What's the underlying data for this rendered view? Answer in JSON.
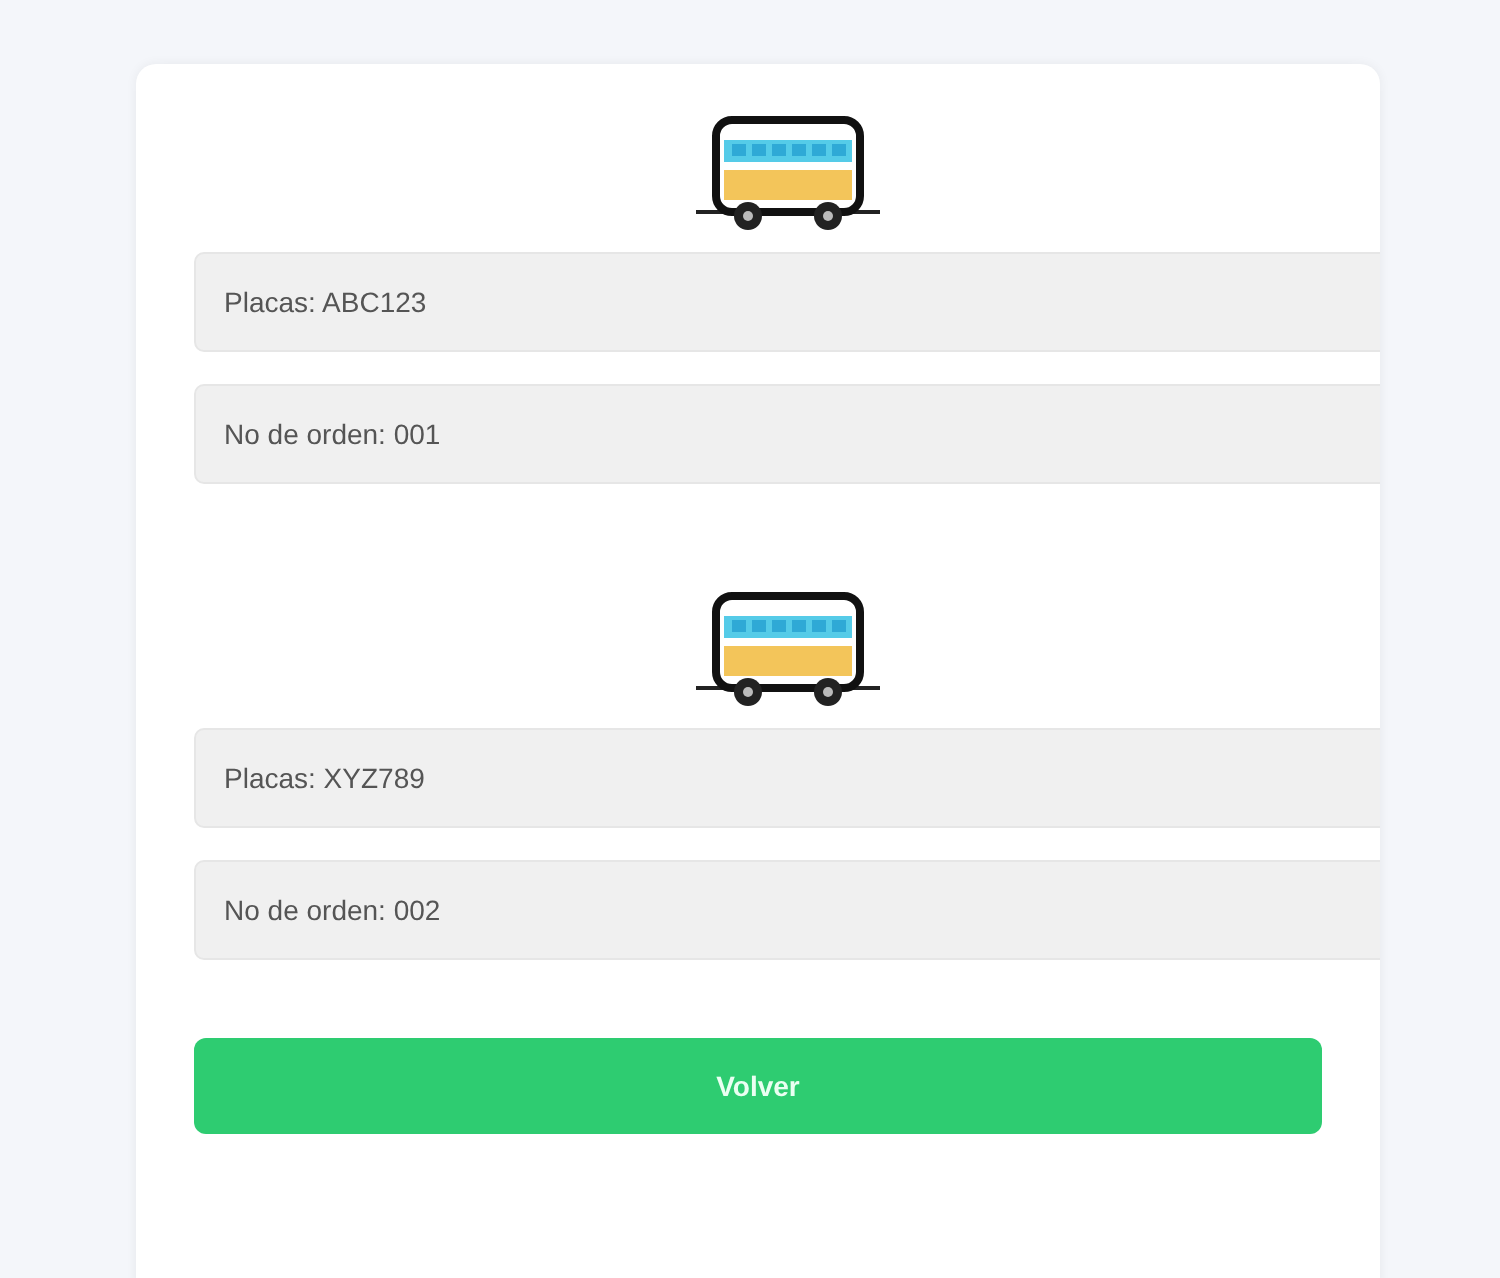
{
  "vehicles": [
    {
      "plates": "Placas: ABC123",
      "order": "No de orden: 001"
    },
    {
      "plates": "Placas: XYZ789",
      "order": "No de orden: 002"
    }
  ],
  "button": "Volver"
}
